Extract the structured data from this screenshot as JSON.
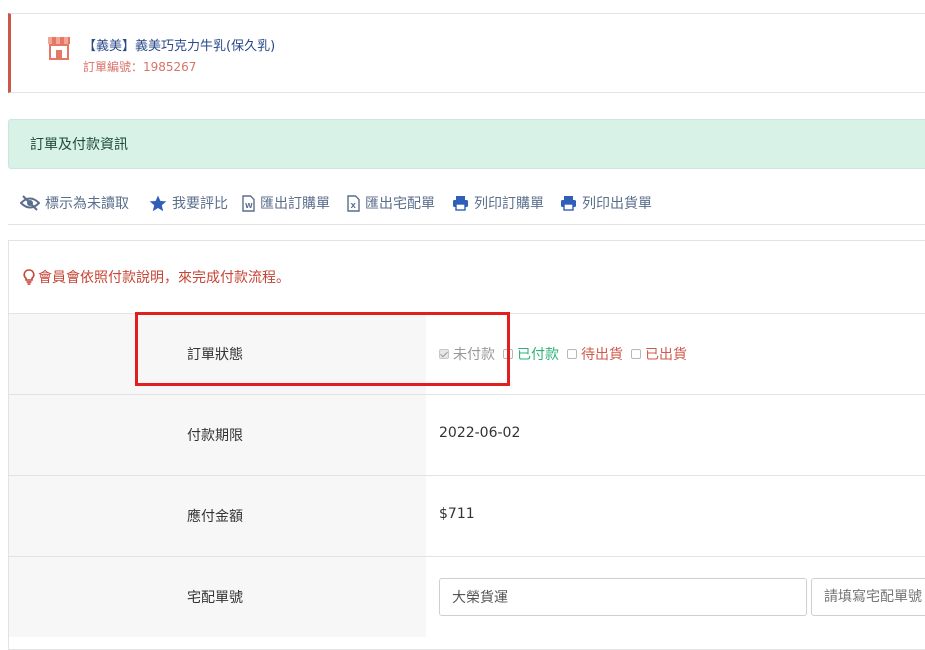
{
  "store": {
    "title": "【義美】義美巧克力牛乳(保久乳)",
    "order_number": "訂單編號：1985267",
    "icon": "store-icon",
    "accent_color": "#c9574a"
  },
  "section": {
    "title": "訂單及付款資訊",
    "bg_color": "#d8f2e8"
  },
  "toolbar": {
    "mark_unread": "標示為未讀取",
    "rate": "我要評比",
    "export_order": "匯出訂購單",
    "export_delivery": "匯出宅配單",
    "print_order": "列印訂購單",
    "print_shipping": "列印出貨單"
  },
  "notice": {
    "text": "會員會依照付款說明，來完成付款流程。",
    "icon": "lightbulb-icon"
  },
  "rows": {
    "status": {
      "label": "訂單狀態",
      "options": [
        "未付款",
        "已付款",
        "待出貨",
        "已出貨"
      ],
      "checked": "未付款"
    },
    "deadline": {
      "label": "付款期限",
      "value": "2022-06-02"
    },
    "amount": {
      "label": "應付金額",
      "value": "$711"
    },
    "tracking": {
      "label": "宅配單號",
      "carrier_value": "大榮貨運",
      "tracking_placeholder": "請填寫宅配單號"
    }
  },
  "colors": {
    "paid": "#2fb07a",
    "pending": "#d05a4c",
    "link": "#5a6e8c",
    "highlight": "#e02020"
  }
}
